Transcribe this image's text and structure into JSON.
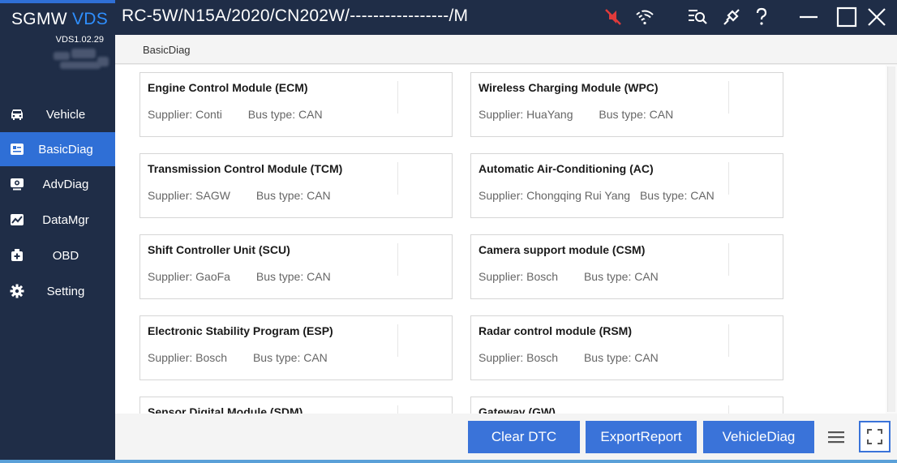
{
  "app": {
    "brand_sgmw": "SGMW",
    "brand_vds": "VDS",
    "version": "VDS1.02.29"
  },
  "titlebar": {
    "vehicle_path": "RC-5W/N15A/2020/CN202W/-----------------/M",
    "icons": [
      "mute-icon",
      "wifi-off-icon",
      "search-list-icon",
      "connector-icon",
      "help-icon",
      "minimize-icon",
      "maximize-icon",
      "close-icon"
    ]
  },
  "sidebar": {
    "items": [
      {
        "label": "Vehicle",
        "icon": "car-icon",
        "active": false
      },
      {
        "label": "BasicDiag",
        "icon": "clipboard-icon",
        "active": true
      },
      {
        "label": "AdvDiag",
        "icon": "monitor-icon",
        "active": false
      },
      {
        "label": "DataMgr",
        "icon": "chart-icon",
        "active": false
      },
      {
        "label": "OBD",
        "icon": "medkit-icon",
        "active": false
      },
      {
        "label": "Setting",
        "icon": "gear-icon",
        "active": false
      }
    ]
  },
  "breadcrumb": "BasicDiag",
  "modules": [
    {
      "name": "Engine Control Module (ECM)",
      "supplier_label": "Supplier:",
      "supplier": "Conti",
      "bus_label": "Bus type:",
      "bus": "CAN"
    },
    {
      "name": "Wireless Charging Module (WPC)",
      "supplier_label": "Supplier:",
      "supplier": "HuaYang",
      "bus_label": "Bus type:",
      "bus": "CAN"
    },
    {
      "name": "Transmission Control Module (TCM)",
      "supplier_label": "Supplier:",
      "supplier": "SAGW",
      "bus_label": "Bus type:",
      "bus": "CAN"
    },
    {
      "name": "Automatic Air-Conditioning (AC)",
      "supplier_label": "Supplier:",
      "supplier": "Chongqing Rui Yang",
      "bus_label": "Bus type:",
      "bus": "CAN"
    },
    {
      "name": "Shift Controller Unit (SCU)",
      "supplier_label": "Supplier:",
      "supplier": "GaoFa",
      "bus_label": "Bus type:",
      "bus": "CAN"
    },
    {
      "name": "Camera support module (CSM)",
      "supplier_label": "Supplier:",
      "supplier": "Bosch",
      "bus_label": "Bus type:",
      "bus": "CAN"
    },
    {
      "name": "Electronic Stability Program (ESP)",
      "supplier_label": "Supplier:",
      "supplier": "Bosch",
      "bus_label": "Bus type:",
      "bus": "CAN"
    },
    {
      "name": "Radar control module (RSM)",
      "supplier_label": "Supplier:",
      "supplier": "Bosch",
      "bus_label": "Bus type:",
      "bus": "CAN"
    },
    {
      "name": "Sensor Digital Module (SDM)",
      "supplier_label": "",
      "supplier": "",
      "bus_label": "",
      "bus": ""
    },
    {
      "name": "Gateway (GW)",
      "supplier_label": "",
      "supplier": "",
      "bus_label": "",
      "bus": ""
    }
  ],
  "actions": {
    "clear_dtc": "Clear DTC",
    "export_report": "ExportReport",
    "vehicle_diag": "VehicleDiag"
  },
  "colors": {
    "sidebar_bg": "#1f2d47",
    "accent": "#2f6fd6",
    "button": "#3a73d9",
    "brand_vds": "#2f8fff",
    "mute_red": "#e03b3b"
  }
}
